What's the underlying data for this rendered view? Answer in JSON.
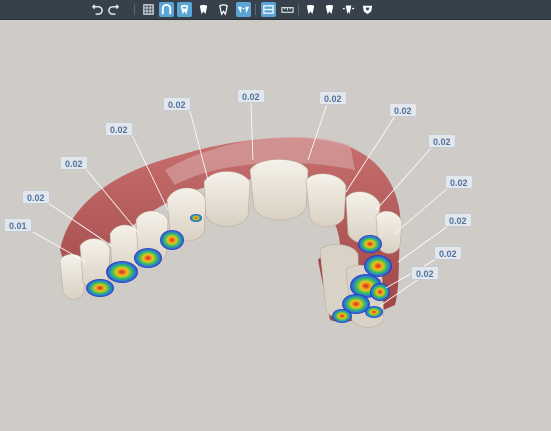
{
  "toolbar": {
    "buttons": [
      {
        "name": "undo-button",
        "icon": "undo-icon",
        "active": false
      },
      {
        "name": "redo-button",
        "icon": "redo-icon",
        "active": false
      },
      {
        "name": "grid-toggle-button",
        "icon": "grid-icon",
        "active": false
      },
      {
        "name": "arch-view-button",
        "icon": "arch-icon",
        "active": true
      },
      {
        "name": "tooth-attachment-button",
        "icon": "tooth-attachment-icon",
        "active": true
      },
      {
        "name": "tooth-view-button",
        "icon": "tooth-icon",
        "active": false
      },
      {
        "name": "single-tooth-button",
        "icon": "single-tooth-icon",
        "active": false
      },
      {
        "name": "teeth-spacing-button",
        "icon": "teeth-spacing-icon",
        "active": true
      },
      {
        "name": "occlusal-plane-button",
        "icon": "occlusal-plane-icon",
        "active": true
      },
      {
        "name": "ruler-button",
        "icon": "ruler-icon",
        "active": false
      },
      {
        "name": "tooth-left-button",
        "icon": "tooth-left-icon",
        "active": false
      },
      {
        "name": "tooth-right-button",
        "icon": "tooth-right-icon",
        "active": false
      },
      {
        "name": "tooth-expand-button",
        "icon": "tooth-expand-icon",
        "active": false
      },
      {
        "name": "tooth-shield-button",
        "icon": "tooth-shield-icon",
        "active": false
      }
    ]
  },
  "colors": {
    "toolbar_bg": "#36414b",
    "active_button": "#5aa5d6",
    "background": "#cfcbc7",
    "gum": "#b55a5a",
    "tooth": "#ece6dc",
    "tag_text": "#4e74a0"
  },
  "measurements": [
    {
      "value": "0.01"
    },
    {
      "value": "0.02"
    },
    {
      "value": "0.02"
    },
    {
      "value": "0.02"
    },
    {
      "value": "0.02"
    },
    {
      "value": "0.02"
    },
    {
      "value": "0.02"
    },
    {
      "value": "0.02"
    },
    {
      "value": "0.02"
    },
    {
      "value": "0.02"
    },
    {
      "value": "0.02"
    },
    {
      "value": "0.02"
    },
    {
      "value": "0.02"
    }
  ]
}
